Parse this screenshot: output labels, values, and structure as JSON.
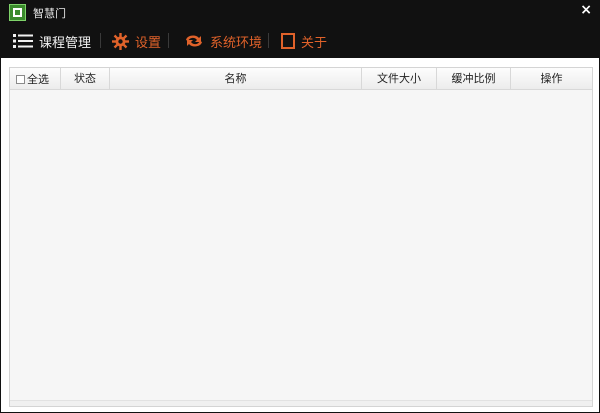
{
  "window": {
    "title": "智慧门",
    "close_glyph": "×"
  },
  "toolbar": {
    "course_label": "课程管理",
    "settings_label": "设置",
    "env_label": "系统环境",
    "about_label": "关于"
  },
  "colors": {
    "accent": "#e0622a",
    "titlebar": "#111111",
    "app_icon": "#3a8a2c"
  },
  "table": {
    "columns": {
      "select_all": "全选",
      "status": "状态",
      "name": "名称",
      "size": "文件大小",
      "buffer": "缓冲比例",
      "ops": "操作"
    },
    "rows": []
  },
  "icons": {
    "course": "list-icon",
    "settings": "gear-icon",
    "env": "refresh-icon",
    "about": "page-icon"
  }
}
